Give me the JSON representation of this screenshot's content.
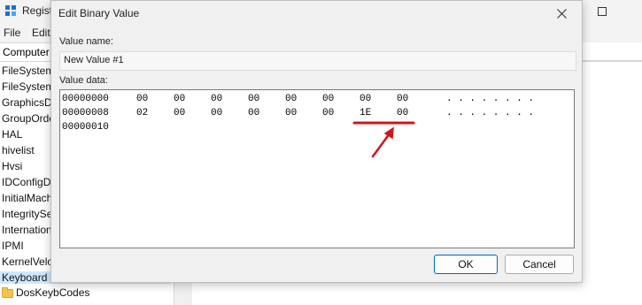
{
  "registry_editor": {
    "title": "Regist",
    "menu": [
      "File",
      "Edit"
    ],
    "address": "Computer",
    "tree_items": [
      "FileSystem",
      "FileSystem",
      "GraphicsDr",
      "GroupOrde",
      "HAL",
      "hivelist",
      "Hvsi",
      "IDConfigD",
      "InitialMach",
      "IntegritySe",
      "Internation",
      "IPMI",
      "KernelVelo",
      "Keyboard L"
    ],
    "subkey": "DosKeybCodes"
  },
  "dialog": {
    "title": "Edit Binary Value",
    "value_name_label": "Value name:",
    "value_name": "New Value #1",
    "value_data_label": "Value data:",
    "rows": [
      {
        "offset": "00000000",
        "bytes": [
          "00",
          "00",
          "00",
          "00",
          "00",
          "00",
          "00",
          "00"
        ],
        "ascii": ". . . . . . . ."
      },
      {
        "offset": "00000008",
        "bytes": [
          "02",
          "00",
          "00",
          "00",
          "00",
          "00",
          "1E",
          "00"
        ],
        "ascii": ". . . . . . . ."
      },
      {
        "offset": "00000010",
        "bytes": [],
        "ascii": ""
      }
    ],
    "ok_label": "OK",
    "cancel_label": "Cancel"
  },
  "annotation_color": "#d0141c"
}
